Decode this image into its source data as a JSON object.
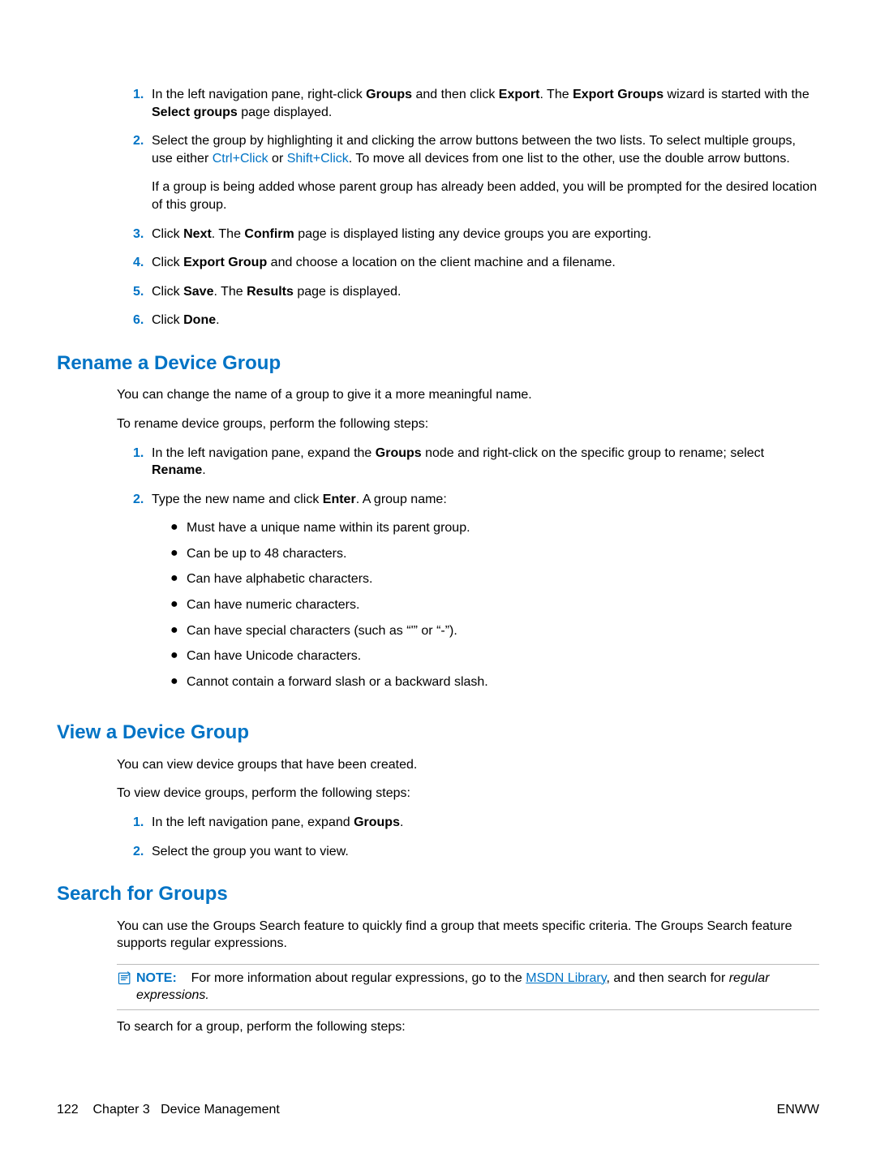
{
  "list1": [
    {
      "n": "1.",
      "parts": [
        {
          "runs": [
            {
              "t": "In the left navigation pane, right-click "
            },
            {
              "t": "Groups",
              "b": true
            },
            {
              "t": " and then click "
            },
            {
              "t": "Export",
              "b": true
            },
            {
              "t": ". The "
            },
            {
              "t": "Export Groups",
              "b": true
            },
            {
              "t": " wizard is started with the "
            },
            {
              "t": "Select groups",
              "b": true
            },
            {
              "t": " page displayed."
            }
          ]
        }
      ]
    },
    {
      "n": "2.",
      "parts": [
        {
          "runs": [
            {
              "t": "Select the group by highlighting it and clicking the arrow buttons between the two lists. To select multiple groups, use either "
            },
            {
              "t": "Ctrl+Click",
              "kbd": true
            },
            {
              "t": " or "
            },
            {
              "t": "Shift+Click",
              "kbd": true
            },
            {
              "t": ". To move all devices from one list to the other, use the double arrow buttons."
            }
          ]
        },
        {
          "runs": [
            {
              "t": "If a group is being added whose parent group has already been added, you will be prompted for the desired location of this group."
            }
          ]
        }
      ]
    },
    {
      "n": "3.",
      "parts": [
        {
          "runs": [
            {
              "t": "Click "
            },
            {
              "t": "Next",
              "b": true
            },
            {
              "t": ". The "
            },
            {
              "t": "Confirm",
              "b": true
            },
            {
              "t": " page is displayed listing any device groups you are exporting."
            }
          ]
        }
      ]
    },
    {
      "n": "4.",
      "parts": [
        {
          "runs": [
            {
              "t": "Click "
            },
            {
              "t": "Export Group",
              "b": true
            },
            {
              "t": " and choose a location on the client machine and a filename."
            }
          ]
        }
      ]
    },
    {
      "n": "5.",
      "parts": [
        {
          "runs": [
            {
              "t": "Click "
            },
            {
              "t": "Save",
              "b": true
            },
            {
              "t": ". The "
            },
            {
              "t": "Results",
              "b": true
            },
            {
              "t": " page is displayed."
            }
          ]
        }
      ]
    },
    {
      "n": "6.",
      "parts": [
        {
          "runs": [
            {
              "t": "Click "
            },
            {
              "t": "Done",
              "b": true
            },
            {
              "t": "."
            }
          ]
        }
      ]
    }
  ],
  "section2": {
    "title": "Rename a Device Group",
    "p1": "You can change the name of a group to give it a more meaningful name.",
    "p2": "To rename device groups, perform the following steps:",
    "list": [
      {
        "n": "1.",
        "runs": [
          {
            "t": "In the left navigation pane, expand the "
          },
          {
            "t": "Groups",
            "b": true
          },
          {
            "t": " node and right-click on the specific group to rename; select "
          },
          {
            "t": "Rename",
            "b": true
          },
          {
            "t": "."
          }
        ]
      },
      {
        "n": "2.",
        "runs": [
          {
            "t": "Type the new name and click "
          },
          {
            "t": "Enter",
            "b": true
          },
          {
            "t": ". A group name:"
          }
        ],
        "bullets": [
          "Must have a unique name within its parent group.",
          "Can be up to 48 characters.",
          "Can have alphabetic characters.",
          "Can have numeric characters.",
          "Can have special characters (such as “'” or “-”).",
          "Can have Unicode characters.",
          "Cannot contain a forward slash or a backward slash."
        ]
      }
    ]
  },
  "section3": {
    "title": "View a Device Group",
    "p1": "You can view device groups that have been created.",
    "p2": "To view device groups, perform the following steps:",
    "list": [
      {
        "n": "1.",
        "runs": [
          {
            "t": "In the left navigation pane, expand "
          },
          {
            "t": "Groups",
            "b": true
          },
          {
            "t": "."
          }
        ]
      },
      {
        "n": "2.",
        "runs": [
          {
            "t": "Select the group you want to view."
          }
        ]
      }
    ]
  },
  "section4": {
    "title": "Search for Groups",
    "p1": "You can use the Groups Search feature to quickly find a group that meets specific criteria. The Groups Search feature supports regular expressions.",
    "note": {
      "label": "NOTE:",
      "runs": [
        {
          "t": "For more information about regular expressions, go to the "
        },
        {
          "t": "MSDN Library",
          "link": true
        },
        {
          "t": ", and then search for "
        },
        {
          "t": "regular expressions.",
          "i": true
        }
      ]
    },
    "p2": "To search for a group, perform the following steps:"
  },
  "footer": {
    "left_page": "122",
    "left_chapter": "Chapter 3   Device Management",
    "right": "ENWW"
  }
}
